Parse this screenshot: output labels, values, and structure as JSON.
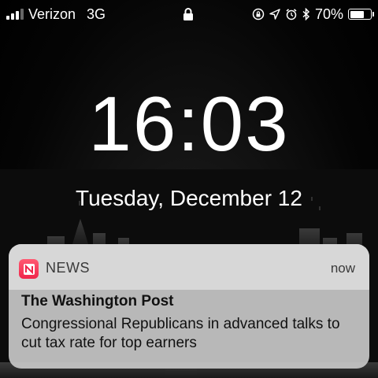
{
  "status_bar": {
    "carrier": "Verizon",
    "network": "3G",
    "battery_percent": "70%",
    "battery_level": 0.7,
    "signal_bars_on": 3,
    "signal_bars_total": 4
  },
  "lock_screen": {
    "time": "16:03",
    "date": "Tuesday, December 12"
  },
  "notification": {
    "app_name": "NEWS",
    "time": "now",
    "title": "The Washington Post",
    "body": "Congressional Republicans in advanced talks to cut tax rate for top earners",
    "icon": "news-app-icon",
    "accent_color": "#f0254a"
  }
}
